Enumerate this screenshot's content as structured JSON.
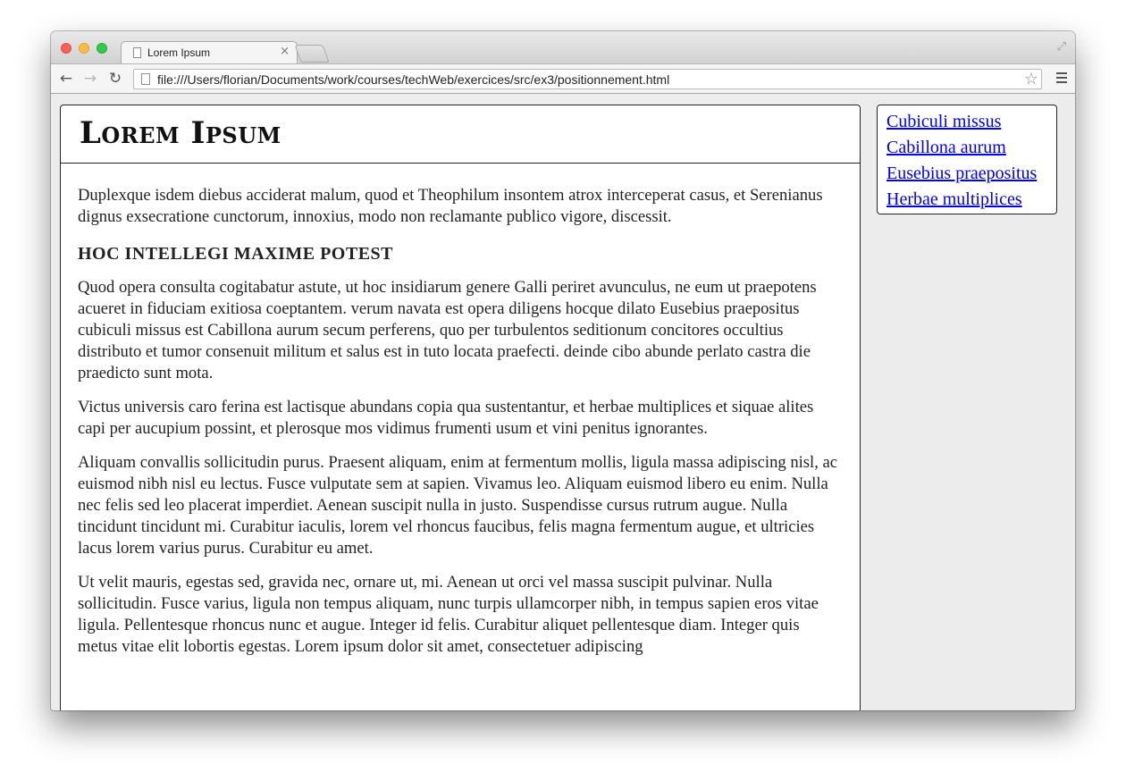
{
  "browser": {
    "tab_title": "Lorem Ipsum",
    "tab_close": "×",
    "url": "file:///Users/florian/Documents/work/courses/techWeb/exercices/src/ex3/positionnement.html",
    "back": "←",
    "forward": "→",
    "reload": "↻",
    "star": "☆",
    "fullscreen": "⤢"
  },
  "page": {
    "title": "Lorem Ipsum",
    "intro": "Duplexque isdem diebus acciderat malum, quod et Theophilum insontem atrox interceperat casus, et Serenianus dignus exsecratione cunctorum, innoxius, modo non reclamante publico vigore, discessit.",
    "subheading": "HOC INTELLEGI MAXIME POTEST",
    "paragraphs": [
      "Quod opera consulta cogitabatur astute, ut hoc insidiarum genere Galli periret avunculus, ne eum ut praepotens acueret in fiduciam exitiosa coeptantem. verum navata est opera diligens hocque dilato Eusebius praepositus cubiculi missus est Cabillona aurum secum perferens, quo per turbulentos seditionum concitores occultius distributo et tumor consenuit militum et salus est in tuto locata praefecti. deinde cibo abunde perlato castra die praedicto sunt mota.",
      "Victus universis caro ferina est lactisque abundans copia qua sustentantur, et herbae multiplices et siquae alites capi per aucupium possint, et plerosque mos vidimus frumenti usum et vini penitus ignorantes.",
      "Aliquam convallis sollicitudin purus. Praesent aliquam, enim at fermentum mollis, ligula massa adipiscing nisl, ac euismod nibh nisl eu lectus. Fusce vulputate sem at sapien. Vivamus leo. Aliquam euismod libero eu enim. Nulla nec felis sed leo placerat imperdiet. Aenean suscipit nulla in justo. Suspendisse cursus rutrum augue. Nulla tincidunt tincidunt mi. Curabitur iaculis, lorem vel rhoncus faucibus, felis magna fermentum augue, et ultricies lacus lorem varius purus. Curabitur eu amet.",
      "Ut velit mauris, egestas sed, gravida nec, ornare ut, mi. Aenean ut orci vel massa suscipit pulvinar. Nulla sollicitudin. Fusce varius, ligula non tempus aliquam, nunc turpis ullamcorper nibh, in tempus sapien eros vitae ligula. Pellentesque rhoncus nunc et augue. Integer id felis. Curabitur aliquet pellentesque diam. Integer quis metus vitae elit lobortis egestas. Lorem ipsum dolor sit amet, consectetuer adipiscing"
    ],
    "nav_links": [
      "Cubiculi missus",
      "Cabillona aurum",
      "Eusebius praepositus",
      "Herbae multiplices"
    ]
  },
  "colors": {
    "link": "#0000ee",
    "traffic_close": "#fc605c",
    "traffic_minimize": "#fdbc40",
    "traffic_maximize": "#34c84a"
  }
}
